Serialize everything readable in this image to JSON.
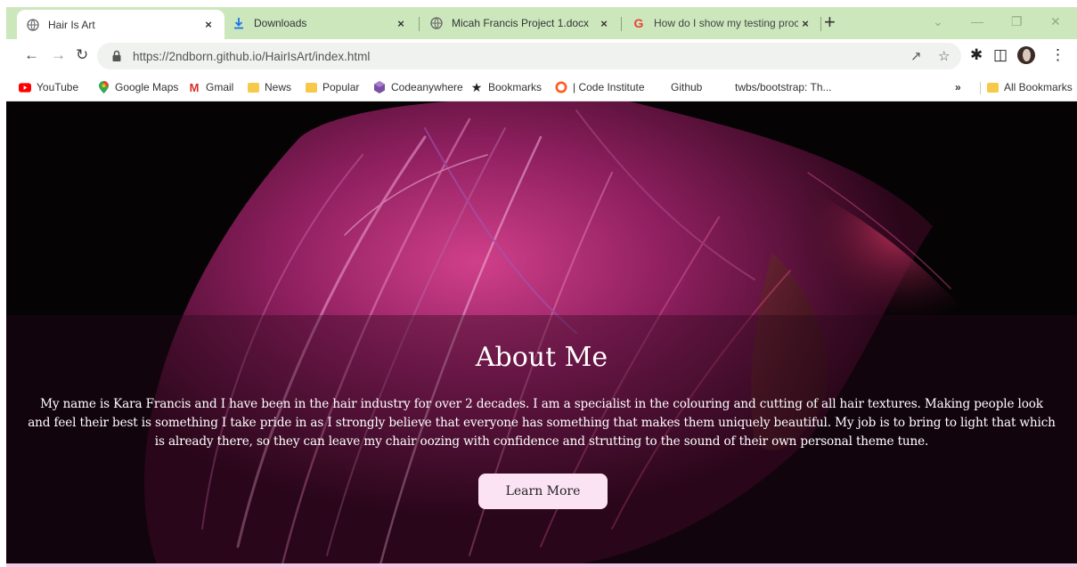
{
  "browser": {
    "tabs": [
      {
        "label": "Hair Is Art",
        "icon": "globe-icon",
        "active": true
      },
      {
        "label": "Downloads",
        "icon": "download-icon",
        "active": false
      },
      {
        "label": "Micah Francis Project 1.docx",
        "icon": "globe-icon",
        "active": false
      },
      {
        "label": "How do I show my testing proce",
        "icon": "google-icon",
        "active": false
      }
    ],
    "tab_close_glyph": "×",
    "new_tab_glyph": "+",
    "url": "https://2ndborn.github.io/HairIsArt/index.html",
    "bookmarks": [
      {
        "label": "YouTube",
        "icon": "youtube-icon"
      },
      {
        "label": "Google Maps",
        "icon": "maps-pin-icon"
      },
      {
        "label": "Gmail",
        "icon": "gmail-icon"
      },
      {
        "label": "News",
        "icon": "folder-icon"
      },
      {
        "label": "Popular",
        "icon": "folder-icon"
      },
      {
        "label": "Codeanywhere",
        "icon": "codeanywhere-icon"
      },
      {
        "label": "Bookmarks",
        "icon": "star-icon"
      },
      {
        "label": "| Code Institute",
        "icon": "code-institute-icon"
      },
      {
        "label": "Github",
        "icon": "none"
      },
      {
        "label": "twbs/bootstrap: Th...",
        "icon": "none"
      }
    ],
    "overflow_glyph": "»",
    "all_bookmarks_label": "All Bookmarks",
    "colors": {
      "tabstrip": "#cde7bd",
      "omnibox": "#f0f2ef"
    }
  },
  "hero": {
    "title": "About Me",
    "text": "My name is Kara Francis and I have been in the hair industry for over 2 decades. I am a specialist in the colouring and cutting of all hair textures. Making people look and feel their best is something I take pride in as I strongly believe that everyone has something that makes them uniquely beautiful. My job is to bring to light that which is already there, so they can leave my chair oozing with confidence and strutting to the sound of their own personal theme tune.",
    "button_label": "Learn More",
    "colors": {
      "button_bg": "#fbe3f3",
      "accent_hair": "#c2185b"
    }
  }
}
